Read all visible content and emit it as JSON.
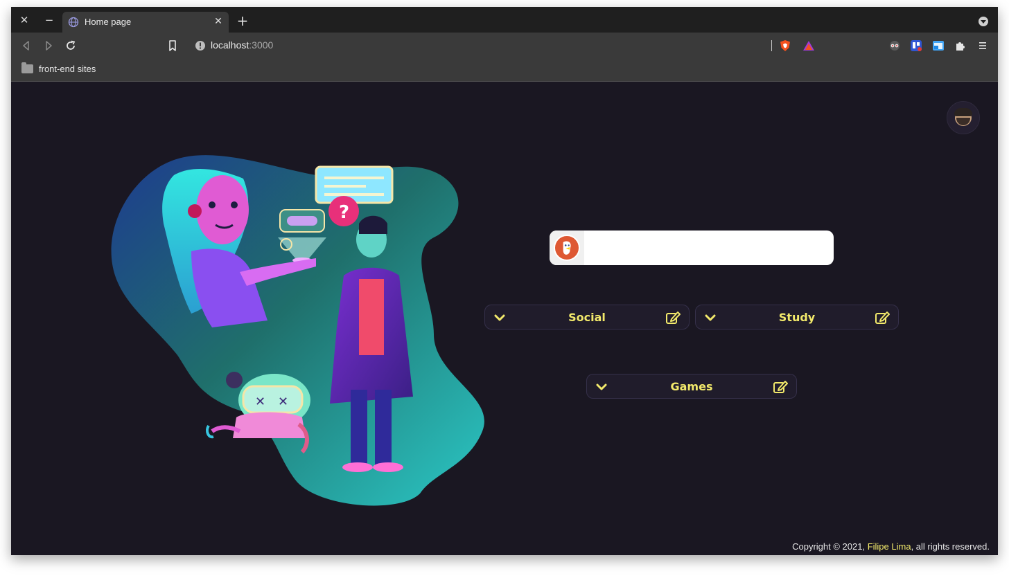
{
  "browser": {
    "tab_title": "Home page",
    "url_host": "localhost",
    "url_port": ":3000",
    "bookmark_folder": "front-end sites"
  },
  "search": {
    "placeholder": "",
    "value": ""
  },
  "categories": [
    {
      "label": "Social",
      "icon": "chevron-down-icon",
      "edit_icon": "edit-icon"
    },
    {
      "label": "Study",
      "icon": "chevron-down-icon",
      "edit_icon": "edit-icon"
    },
    {
      "label": "Games",
      "icon": "chevron-down-icon",
      "edit_icon": "edit-icon"
    }
  ],
  "footer": {
    "prefix": "Copyright © 2021, ",
    "author": "Filipe Lima",
    "suffix": ", all rights reserved."
  },
  "colors": {
    "background": "#1a1722",
    "accent": "#f2e96b",
    "card": "#201c2b"
  }
}
